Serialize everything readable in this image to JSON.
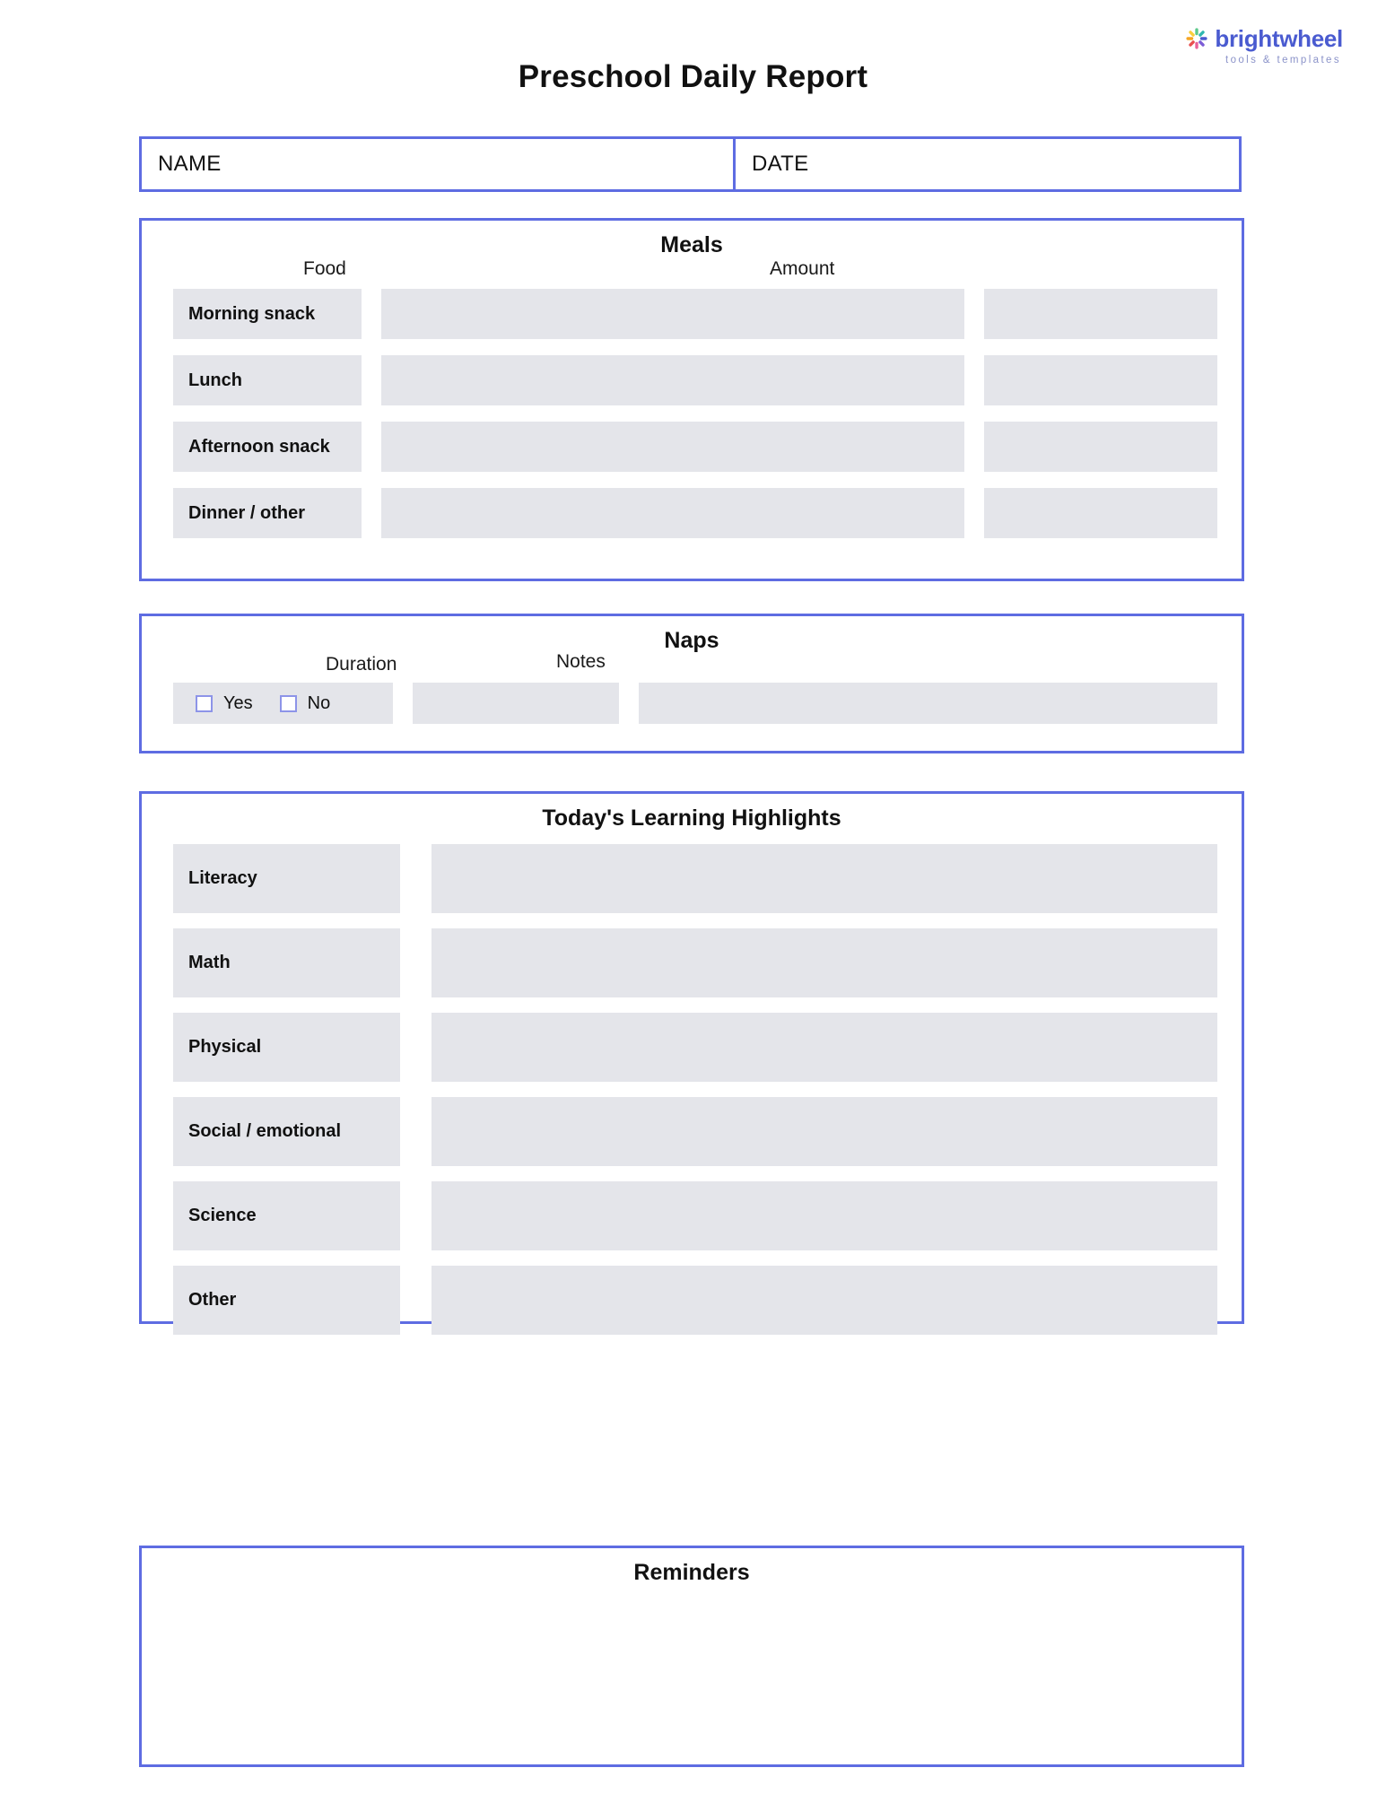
{
  "brand": {
    "mark": "brightwheel-logo-icon",
    "name": "brightwheel",
    "tagline": "tools & templates",
    "word_color": "#4a5bd0",
    "tag_color": "#8b93c9",
    "mark_colors": [
      "#f5a623",
      "#f8cf3d",
      "#5cc98a",
      "#2fb8b0",
      "#4a5bd0",
      "#7b5cd6",
      "#e8609a",
      "#e84f4f"
    ]
  },
  "colors": {
    "border": "#5e6ce2",
    "field_fill": "#e4e5ea",
    "checkbox_border": "#8d94e8",
    "text": "#111111"
  },
  "title": "Preschool Daily Report",
  "identity": {
    "name_label": "NAME",
    "name_value": "",
    "date_label": "DATE",
    "date_value": ""
  },
  "meals": {
    "heading": "Meals",
    "columns": {
      "food": "Food",
      "amount": "Amount"
    },
    "rows": [
      {
        "label": "Morning snack",
        "food": "",
        "amount": ""
      },
      {
        "label": "Lunch",
        "food": "",
        "amount": ""
      },
      {
        "label": "Afternoon snack",
        "food": "",
        "amount": ""
      },
      {
        "label": "Dinner / other",
        "food": "",
        "amount": ""
      }
    ]
  },
  "naps": {
    "heading": "Naps",
    "columns": {
      "duration": "Duration",
      "notes": "Notes"
    },
    "options": [
      {
        "label": "Yes",
        "checked": false
      },
      {
        "label": "No",
        "checked": false
      }
    ],
    "duration_value": "",
    "notes_value": ""
  },
  "learning": {
    "heading": "Today's Learning Highlights",
    "rows": [
      {
        "label": "Literacy",
        "value": ""
      },
      {
        "label": "Math",
        "value": ""
      },
      {
        "label": "Physical",
        "value": ""
      },
      {
        "label": "Social / emotional",
        "value": ""
      },
      {
        "label": "Science",
        "value": ""
      },
      {
        "label": "Other",
        "value": ""
      }
    ]
  },
  "reminders": {
    "heading": "Reminders",
    "value": ""
  }
}
